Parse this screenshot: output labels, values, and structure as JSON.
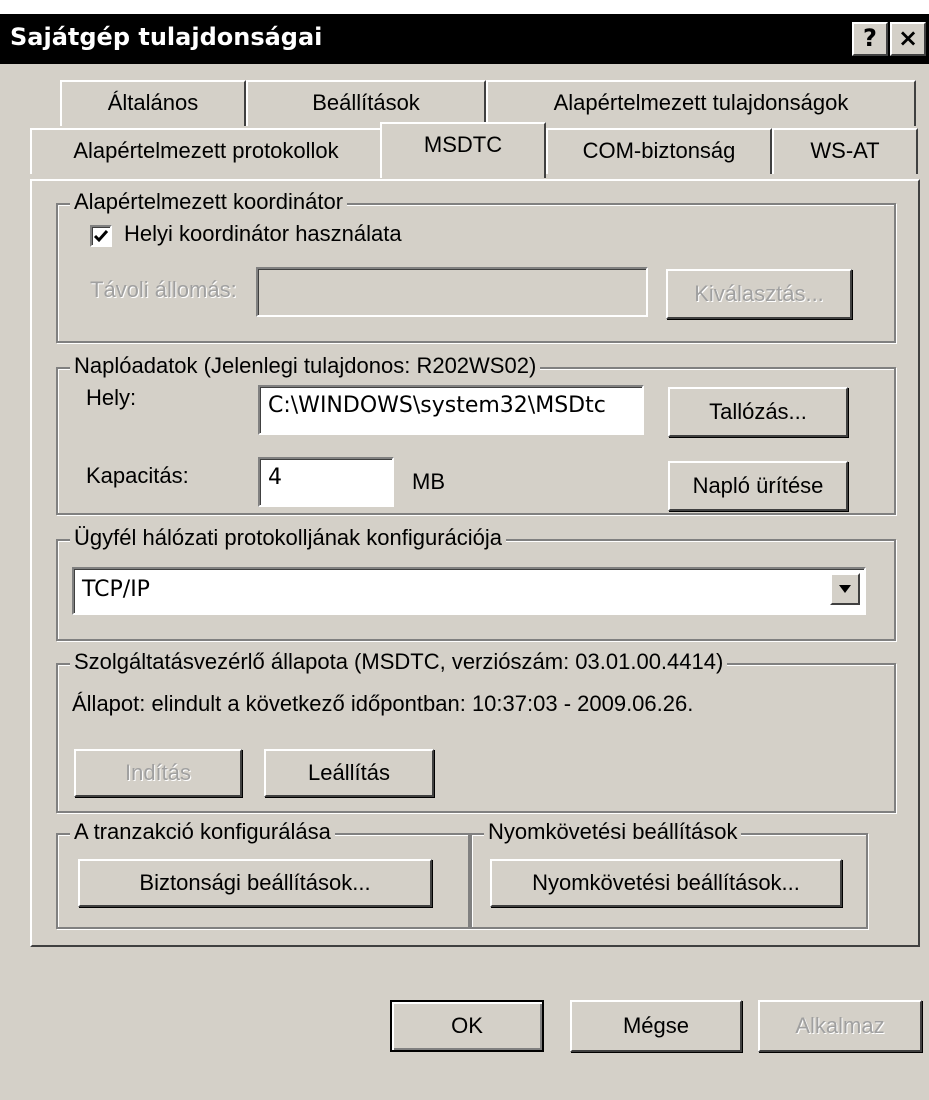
{
  "window": {
    "title": "Sajátgép tulajdonságai",
    "help_label": "?",
    "close_label": "×"
  },
  "tabs": {
    "row1": [
      "Általános",
      "Beállítások",
      "Alapértelmezett tulajdonságok"
    ],
    "row2": [
      "Alapértelmezett protokollok",
      "MSDTC",
      "COM-biztonság",
      "WS-AT"
    ],
    "active": "MSDTC"
  },
  "coordinator": {
    "legend": "Alapértelmezett koordinátor",
    "use_local_label": "Helyi koordinátor használata",
    "use_local_checked": true,
    "remote_host_label": "Távoli állomás:",
    "remote_host_value": "",
    "select_button": "Kiválasztás..."
  },
  "log": {
    "legend": "Naplóadatok (Jelenlegi tulajdonos: R202WS02)",
    "location_label": "Hely:",
    "location_value": "C:\\WINDOWS\\system32\\MSDtc",
    "browse_button": "Tallózás...",
    "capacity_label": "Kapacitás:",
    "capacity_value": "4",
    "capacity_unit": "MB",
    "clear_button": "Napló ürítése"
  },
  "protocol": {
    "legend": "Ügyfél hálózati protokolljának konfigurációja",
    "selected": "TCP/IP"
  },
  "service": {
    "legend": "Szolgáltatásvezérlő állapota (MSDTC, verziószám: 03.01.00.4414)",
    "status_text": "Állapot: elindult a következő időpontban: 10:37:03 - 2009.06.26.",
    "start_button": "Indítás",
    "stop_button": "Leállítás"
  },
  "transaction": {
    "legend": "A tranzakció konfigurálása",
    "security_button": "Biztonsági beállítások..."
  },
  "tracing": {
    "legend": "Nyomkövetési beállítások",
    "tracing_button": "Nyomkövetési beállítások..."
  },
  "footer": {
    "ok_button": "OK",
    "cancel_button": "Mégse",
    "apply_button": "Alkalmaz"
  }
}
